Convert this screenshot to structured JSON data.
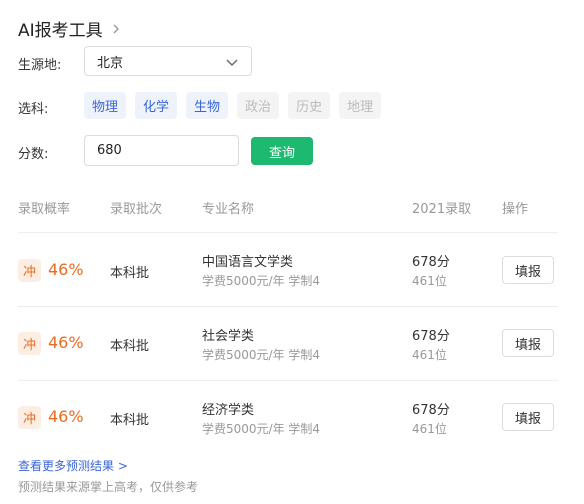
{
  "header": {
    "title": "AI报考工具"
  },
  "form": {
    "source_label": "生源地:",
    "source_value": "北京",
    "subjects_label": "选科:",
    "subjects": [
      {
        "label": "物理",
        "selected": true
      },
      {
        "label": "化学",
        "selected": true
      },
      {
        "label": "生物",
        "selected": true
      },
      {
        "label": "政治",
        "selected": false
      },
      {
        "label": "历史",
        "selected": false
      },
      {
        "label": "地理",
        "selected": false
      }
    ],
    "score_label": "分数:",
    "score_value": "680",
    "query_label": "查询"
  },
  "table": {
    "headers": [
      "录取概率",
      "录取批次",
      "专业名称",
      "2021录取",
      "操作"
    ],
    "rows": [
      {
        "badge": "冲",
        "probability": "46%",
        "batch": "本科批",
        "major": "中国语言文学类",
        "fee": "学费5000元/年 学制4",
        "score": "678分",
        "rank": "461位",
        "action": "填报"
      },
      {
        "badge": "冲",
        "probability": "46%",
        "batch": "本科批",
        "major": "社会学类",
        "fee": "学费5000元/年 学制4",
        "score": "678分",
        "rank": "461位",
        "action": "填报"
      },
      {
        "badge": "冲",
        "probability": "46%",
        "batch": "本科批",
        "major": "经济学类",
        "fee": "学费5000元/年 学制4",
        "score": "678分",
        "rank": "461位",
        "action": "填报"
      }
    ]
  },
  "footer": {
    "more_link": "查看更多预测结果 >",
    "note": "预测结果来源掌上高考，仅供参考"
  },
  "colors": {
    "accent_orange": "#f06a1e",
    "chip_blue": "#3a66d8",
    "button_green": "#1db970"
  }
}
